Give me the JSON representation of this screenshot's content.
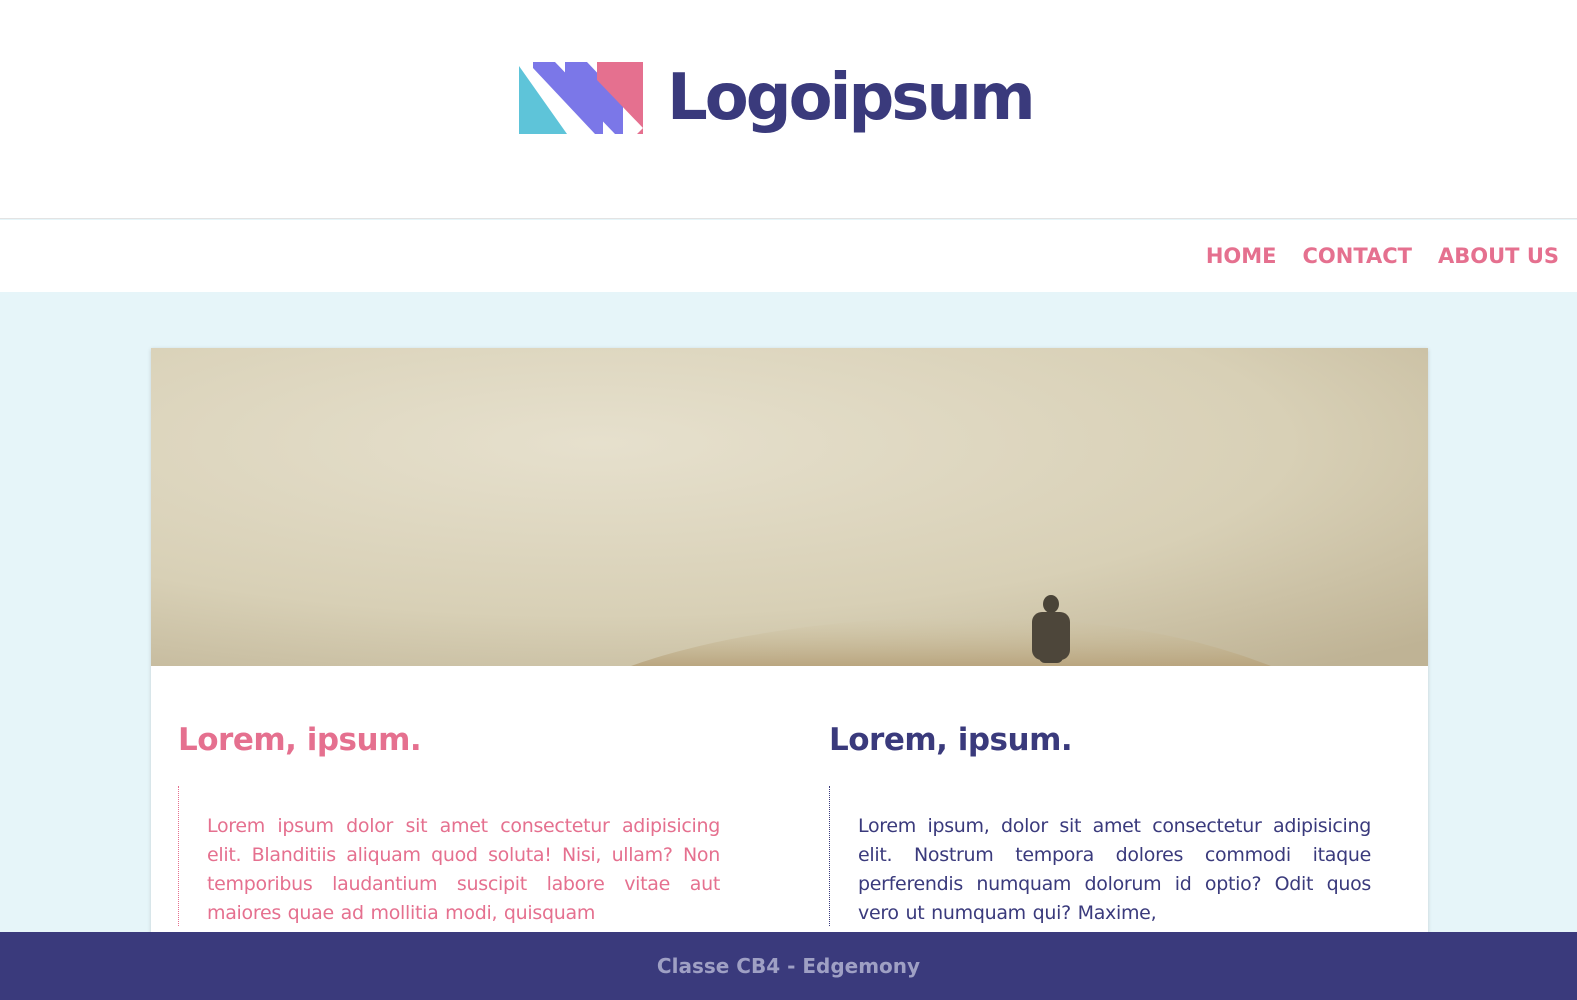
{
  "brand": {
    "name": "Logoipsum",
    "logo_icon": "striped-n-logo-mark",
    "colors": {
      "navy": "#3a3a7c",
      "pink": "#e5708f",
      "violet": "#7b77e8",
      "cyan": "#5ec4d9",
      "page_bg": "#e6f5f9"
    }
  },
  "nav": {
    "items": [
      {
        "label": "HOME"
      },
      {
        "label": "CONTACT"
      },
      {
        "label": "ABOUT US"
      }
    ]
  },
  "hero": {
    "image": "foggy-landscape-person-standing"
  },
  "columns": [
    {
      "title": "Lorem, ipsum.",
      "text": "Lorem ipsum dolor sit amet consectetur adipisicing elit. Blanditiis aliquam quod soluta! Nisi, ullam? Non temporibus laudantium suscipit labore vitae aut maiores quae ad mollitia modi, quisquam"
    },
    {
      "title": "Lorem, ipsum.",
      "text": "Lorem ipsum, dolor sit amet consectetur adipisicing elit. Nostrum tempora dolores commodi itaque perferendis numquam dolorum id optio? Odit quos vero ut numquam qui? Maxime,"
    }
  ],
  "footer": {
    "text": "Classe CB4 - Edgemony"
  }
}
